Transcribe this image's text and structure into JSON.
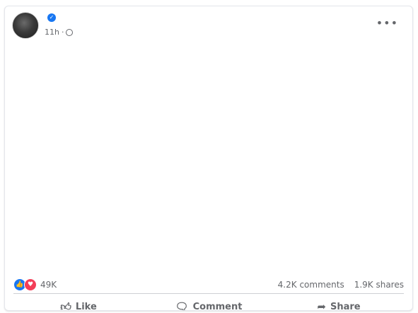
{
  "post": {
    "author": "",
    "verified_icon": "verified-badge-icon",
    "time": "11h",
    "audience_icon": "globe-icon",
    "paragraphs": [
      "",
      "",
      "",
      "",
      "",
      "",
      "",
      ""
    ]
  },
  "stats": {
    "reaction_count": "49K",
    "comments": "4.2K comments",
    "shares": "1.9K shares"
  },
  "actions": {
    "like_label": "Like",
    "comment_label": "Comment",
    "share_label": "Share"
  },
  "colors": {
    "accent": "#1877f2",
    "love": "#f33e58",
    "muted": "#65676b"
  }
}
